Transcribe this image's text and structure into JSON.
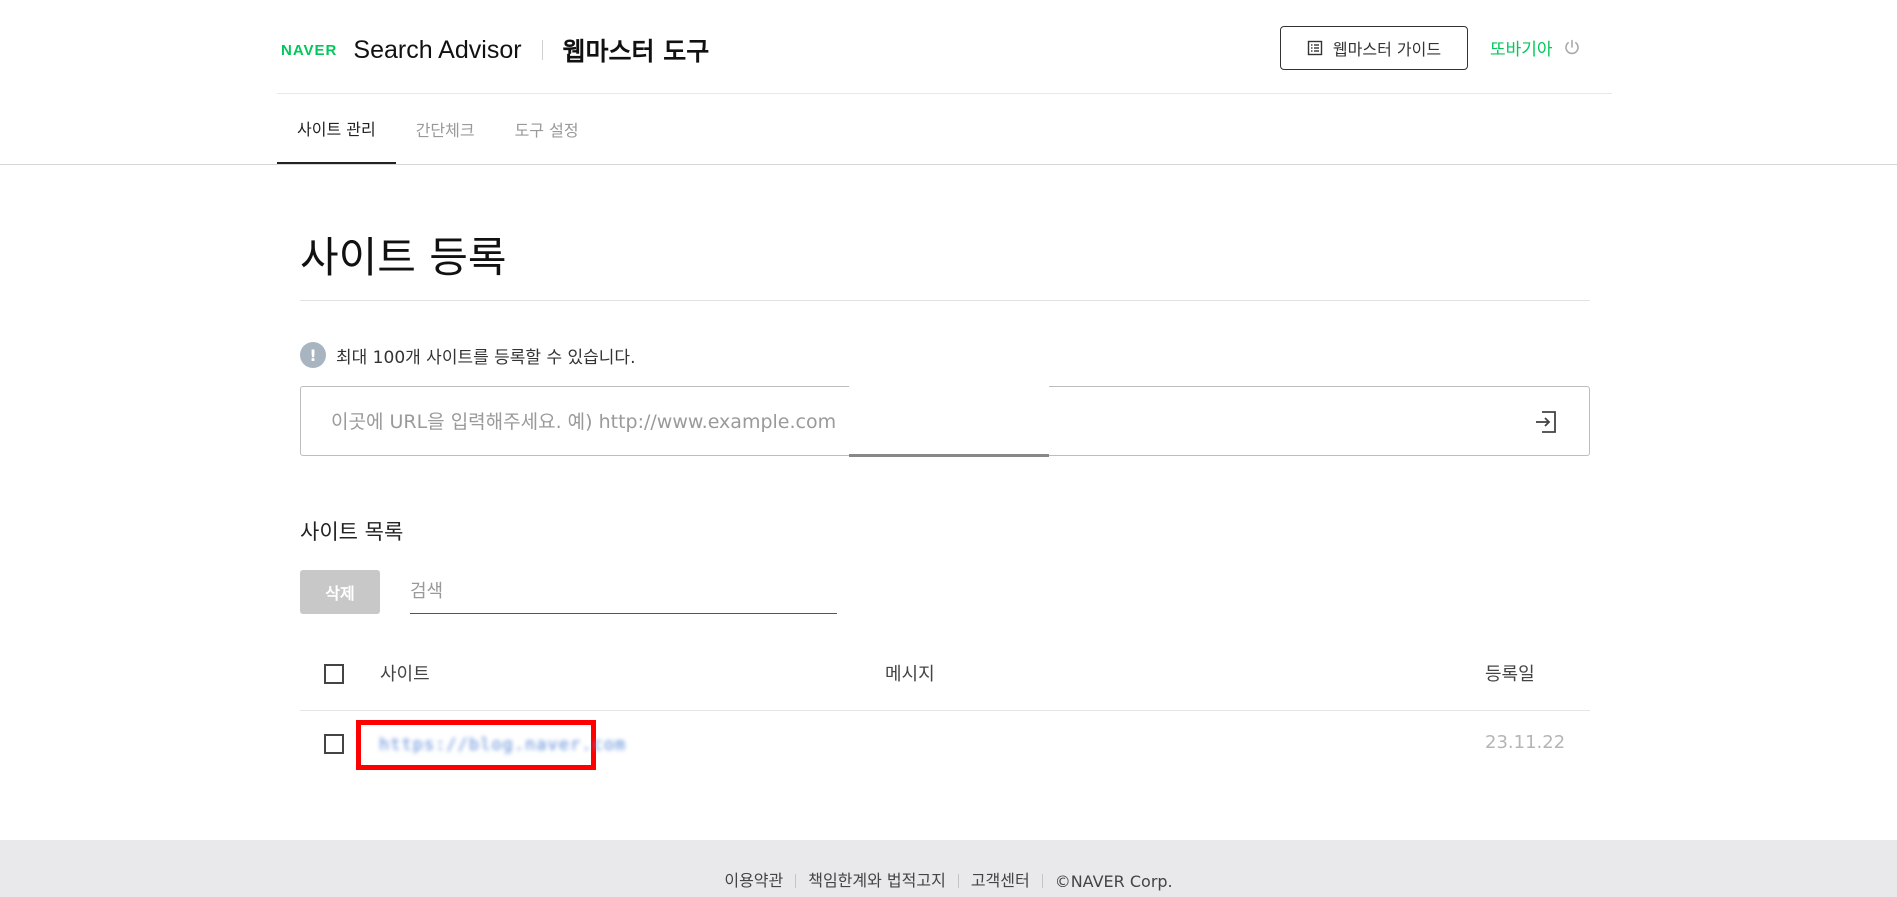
{
  "header": {
    "naver_logo": "NAVER",
    "product": "Search Advisor",
    "tool_title": "웹마스터 도구",
    "guide_button": "웹마스터 가이드",
    "user_name": "또바기아"
  },
  "tabs": [
    {
      "label": "사이트 관리",
      "active": true
    },
    {
      "label": "간단체크",
      "active": false
    },
    {
      "label": "도구 설정",
      "active": false
    }
  ],
  "main": {
    "page_title": "사이트 등록",
    "notice": "최대 100개 사이트를 등록할 수 있습니다.",
    "notice_icon": "!",
    "url_input": {
      "placeholder": "이곳에 URL을 입력해주세요. 예) http://www.example.com",
      "value": ""
    },
    "list_title": "사이트 목록",
    "delete_button": "삭제",
    "search": {
      "placeholder": "검색",
      "value": ""
    },
    "table": {
      "columns": [
        "사이트",
        "메시지",
        "등록일"
      ],
      "rows": [
        {
          "site": "https://blog.naver.com",
          "message": "",
          "date": "23.11.22"
        }
      ]
    }
  },
  "footer": {
    "links": [
      "이용약관",
      "책임한계와 법적고지",
      "고객센터"
    ],
    "copyright": "©NAVER Corp."
  },
  "colors": {
    "brand": "#03c75a",
    "highlight": "#ff0000",
    "disabled_button": "#c8c8c8",
    "footer_bg": "#e9e9ec"
  },
  "icons": {
    "guide": "document-list-icon",
    "logout": "power-icon",
    "notice": "exclamation-circle-icon",
    "submit": "enter-arrow-icon"
  }
}
